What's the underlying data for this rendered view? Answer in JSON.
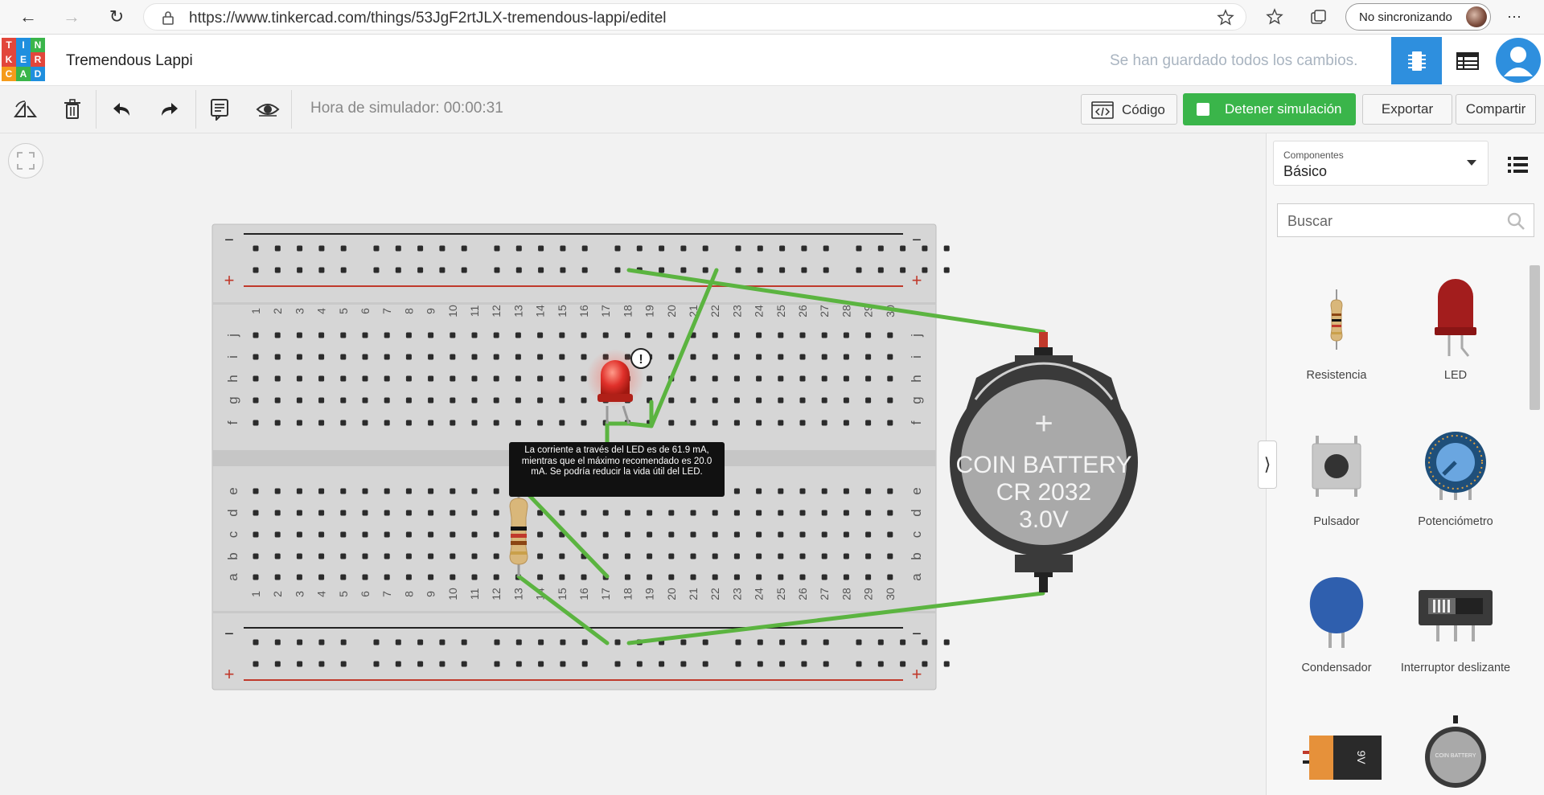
{
  "browser": {
    "url": "https://www.tinkercad.com/things/53JgF2rtJLX-tremendous-lappi/editel",
    "sync_label": "No sincronizando"
  },
  "logo": {
    "letters": [
      "T",
      "I",
      "N",
      "K",
      "E",
      "R",
      "C",
      "A",
      "D"
    ],
    "colors": [
      "#e2463b",
      "#1f8fde",
      "#3ab54a",
      "#e2463b",
      "#1f8fde",
      "#e2463b",
      "#f59b1c",
      "#3ab54a",
      "#1f8fde"
    ]
  },
  "header": {
    "project_title": "Tremendous Lappi",
    "saved_status": "Se han guardado todos los cambios."
  },
  "toolbar": {
    "sim_time": "Hora de simulador: 00:00:31",
    "code_label": "Código",
    "stop_label": "Detener simulación",
    "export_label": "Exportar",
    "share_label": "Compartir"
  },
  "panel": {
    "components_caption": "Componentes",
    "components_value": "Básico",
    "search_placeholder": "Buscar",
    "items": [
      {
        "label": "Resistencia"
      },
      {
        "label": "LED"
      },
      {
        "label": "Pulsador"
      },
      {
        "label": "Potenciómetro"
      },
      {
        "label": "Condensador"
      },
      {
        "label": "Interruptor deslizante"
      }
    ],
    "battery9v_label": "9V",
    "coin_thumb_label": "COIN BATTERY"
  },
  "breadboard": {
    "column_numbers": [
      "1",
      "2",
      "3",
      "4",
      "5",
      "6",
      "7",
      "8",
      "9",
      "10",
      "11",
      "12",
      "13",
      "14",
      "15",
      "16",
      "17",
      "18",
      "19",
      "20",
      "21",
      "22",
      "23",
      "24",
      "25",
      "26",
      "27",
      "28",
      "29",
      "30"
    ],
    "top_rows": [
      "j",
      "i",
      "h",
      "g",
      "f"
    ],
    "bottom_rows": [
      "e",
      "d",
      "c",
      "b",
      "a"
    ],
    "minus": "−",
    "plus": "+"
  },
  "battery": {
    "plus_sign": "+",
    "line1": "COIN BATTERY",
    "line2": "CR 2032",
    "line3": "3.0V"
  },
  "warning": {
    "icon_text": "!",
    "tooltip": "La corriente a través del LED es de 61.9 mA, mientras que el máximo recomendado es 20.0 mA. Se podría reducir la vida útil del LED."
  },
  "colors": {
    "accent": "#2e8fde",
    "stop_green": "#3ab54a",
    "wire_green": "#5bb440",
    "rail_red": "#c0392b",
    "led_red": "#e0302a"
  }
}
